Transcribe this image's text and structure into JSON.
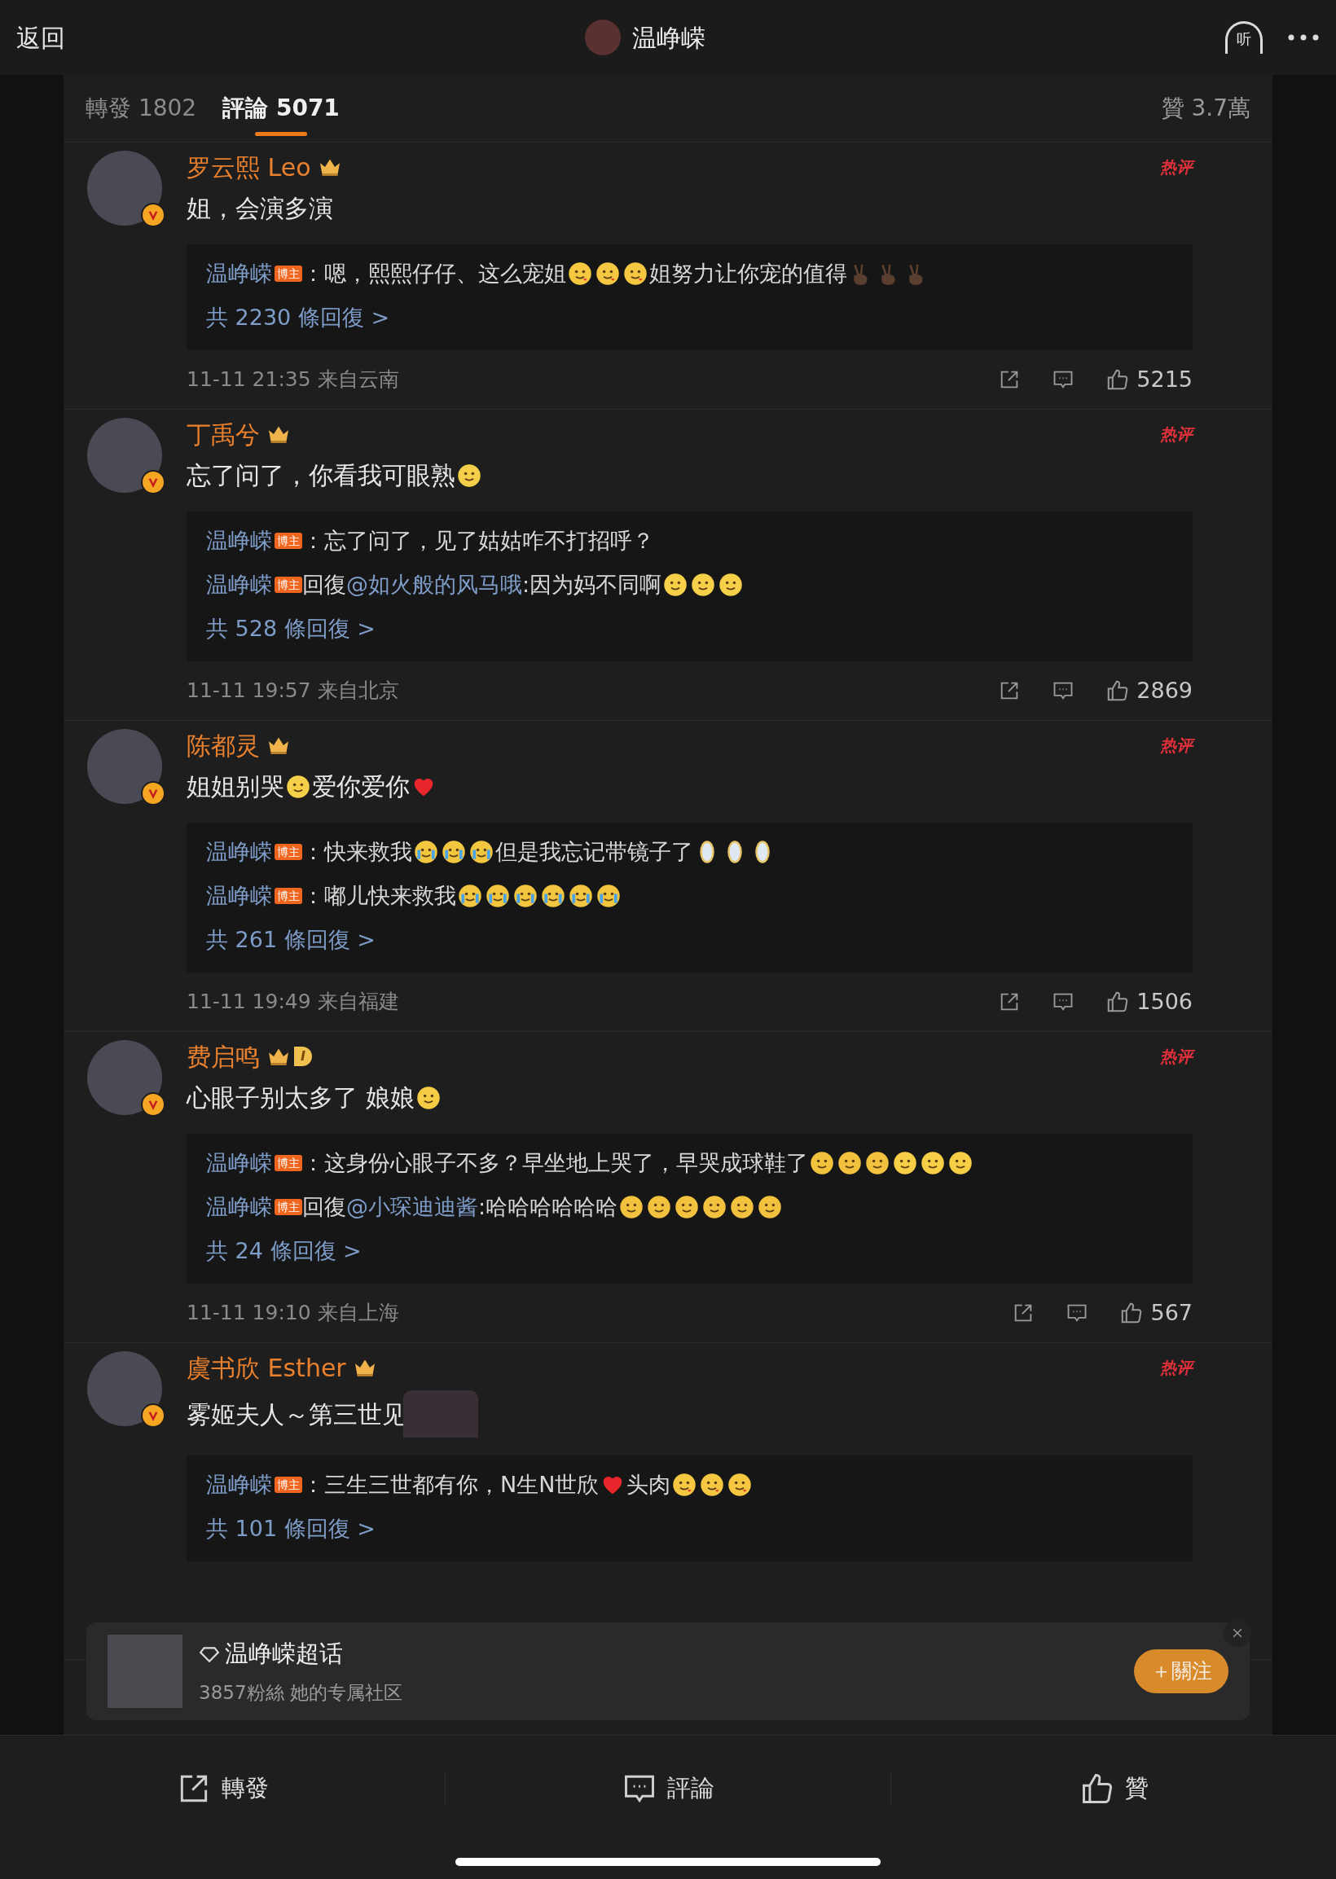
{
  "header": {
    "back": "返回",
    "title": "温峥嵘",
    "listen": "听"
  },
  "tabs": [
    {
      "label": "轉發",
      "count": "1802",
      "selected": false
    },
    {
      "label": "評論",
      "count": "5071",
      "selected": true
    }
  ],
  "likes_total": {
    "label": "贊",
    "count": "3.7萬"
  },
  "comments": [
    {
      "name": "罗云熙 Leo",
      "tag": "热评",
      "verified": true,
      "body": [
        {
          "kind": "text",
          "text": "姐，会演多演"
        }
      ],
      "replies": [
        {
          "author": "温峥嵘",
          "badge": "博主",
          "parts": [
            {
              "kind": "text",
              "text": "：嗯，熙熙仔仔、这么宠姐"
            },
            {
              "kind": "blush"
            },
            {
              "kind": "blush"
            },
            {
              "kind": "blush"
            },
            {
              "kind": "text",
              "text": "姐努力让你宠的值得"
            },
            {
              "kind": "peace"
            },
            {
              "kind": "peace"
            },
            {
              "kind": "peace"
            }
          ]
        }
      ],
      "more": "共 2230 條回復 >",
      "time": "11-11 21:35",
      "location": "来自云南",
      "likes": "5215"
    },
    {
      "name": "丁禹兮",
      "tag": "热评",
      "verified": true,
      "body": [
        {
          "kind": "text",
          "text": "忘了问了，你看我可眼熟"
        },
        {
          "kind": "glasses"
        }
      ],
      "replies": [
        {
          "author": "温峥嵘",
          "badge": "博主",
          "parts": [
            {
              "kind": "text",
              "text": "：忘了问了，见了姑姑咋不打招呼？"
            }
          ]
        },
        {
          "author": "温峥嵘",
          "badge": "博主",
          "parts": [
            {
              "kind": "text",
              "text": " 回復"
            },
            {
              "kind": "mention",
              "text": "@如火般的风马哦"
            },
            {
              "kind": "text",
              "text": ":因为妈不同啊"
            },
            {
              "kind": "smile"
            },
            {
              "kind": "smile"
            },
            {
              "kind": "smile"
            }
          ]
        }
      ],
      "more": "共 528 條回復 >",
      "time": "11-11 19:57",
      "location": "来自北京",
      "likes": "2869"
    },
    {
      "name": "陈都灵",
      "tag": "热评",
      "verified": true,
      "body": [
        {
          "kind": "text",
          "text": "姐姐别哭"
        },
        {
          "kind": "hug"
        },
        {
          "kind": "text",
          "text": "爱你爱你"
        },
        {
          "kind": "heart"
        }
      ],
      "replies": [
        {
          "author": "温峥嵘",
          "badge": "博主",
          "parts": [
            {
              "kind": "text",
              "text": "：快来救我"
            },
            {
              "kind": "cry"
            },
            {
              "kind": "cry"
            },
            {
              "kind": "cry"
            },
            {
              "kind": "text",
              "text": "但是我忘记带镜子了"
            },
            {
              "kind": "mirror"
            },
            {
              "kind": "mirror"
            },
            {
              "kind": "mirror"
            }
          ]
        },
        {
          "author": "温峥嵘",
          "badge": "博主",
          "parts": [
            {
              "kind": "text",
              "text": "：嘟儿快来救我"
            },
            {
              "kind": "cry"
            },
            {
              "kind": "cry"
            },
            {
              "kind": "cry"
            },
            {
              "kind": "cry"
            },
            {
              "kind": "cry"
            },
            {
              "kind": "cry"
            }
          ]
        }
      ],
      "more": "共 261 條回復 >",
      "time": "11-11 19:49",
      "location": "来自福建",
      "likes": "1506"
    },
    {
      "name": "费启鸣",
      "tag": "热评",
      "verified": true,
      "level_badge": "I",
      "body": [
        {
          "kind": "text",
          "text": "心眼子别太多了 娘娘"
        },
        {
          "kind": "yum"
        }
      ],
      "replies": [
        {
          "author": "温峥嵘",
          "badge": "博主",
          "parts": [
            {
              "kind": "text",
              "text": "：这身份心眼子不多？早坐地上哭了，早哭成球鞋了"
            },
            {
              "kind": "grimace"
            },
            {
              "kind": "grimace"
            },
            {
              "kind": "grimace"
            },
            {
              "kind": "laugh"
            },
            {
              "kind": "laugh"
            },
            {
              "kind": "laugh"
            }
          ]
        },
        {
          "author": "温峥嵘",
          "badge": "博主",
          "parts": [
            {
              "kind": "text",
              "text": " 回復"
            },
            {
              "kind": "mention",
              "text": "@小琛迪迪酱"
            },
            {
              "kind": "text",
              "text": ":哈哈哈哈哈哈"
            },
            {
              "kind": "grimace"
            },
            {
              "kind": "grimace"
            },
            {
              "kind": "grimace"
            },
            {
              "kind": "grimace"
            },
            {
              "kind": "grimace"
            },
            {
              "kind": "grimace"
            }
          ]
        }
      ],
      "more": "共 24 條回復 >",
      "time": "11-11 19:10",
      "location": "来自上海",
      "likes": "567"
    },
    {
      "name": "虞书欣 Esther",
      "tag": "热评",
      "verified": true,
      "sticker": true,
      "body": [
        {
          "kind": "text",
          "text": "雾姬夫人～第三世见"
        }
      ],
      "replies": [
        {
          "author": "温峥嵘",
          "badge": "博主",
          "parts": [
            {
              "kind": "text",
              "text": "：三生三世都有你，N生N世欣"
            },
            {
              "kind": "heart"
            },
            {
              "kind": "text",
              "text": "头肉"
            },
            {
              "kind": "blush"
            },
            {
              "kind": "blush"
            },
            {
              "kind": "blush"
            }
          ]
        }
      ],
      "more": "共 101 條回復 >"
    }
  ],
  "supertopic": {
    "title": "温峥嵘超话",
    "subtitle": "3857粉絲 她的专属社区",
    "follow": "＋關注"
  },
  "bottom_bar": [
    {
      "label": "轉發",
      "kind": "share"
    },
    {
      "label": "評論",
      "kind": "comment"
    },
    {
      "label": "贊",
      "kind": "like"
    }
  ]
}
